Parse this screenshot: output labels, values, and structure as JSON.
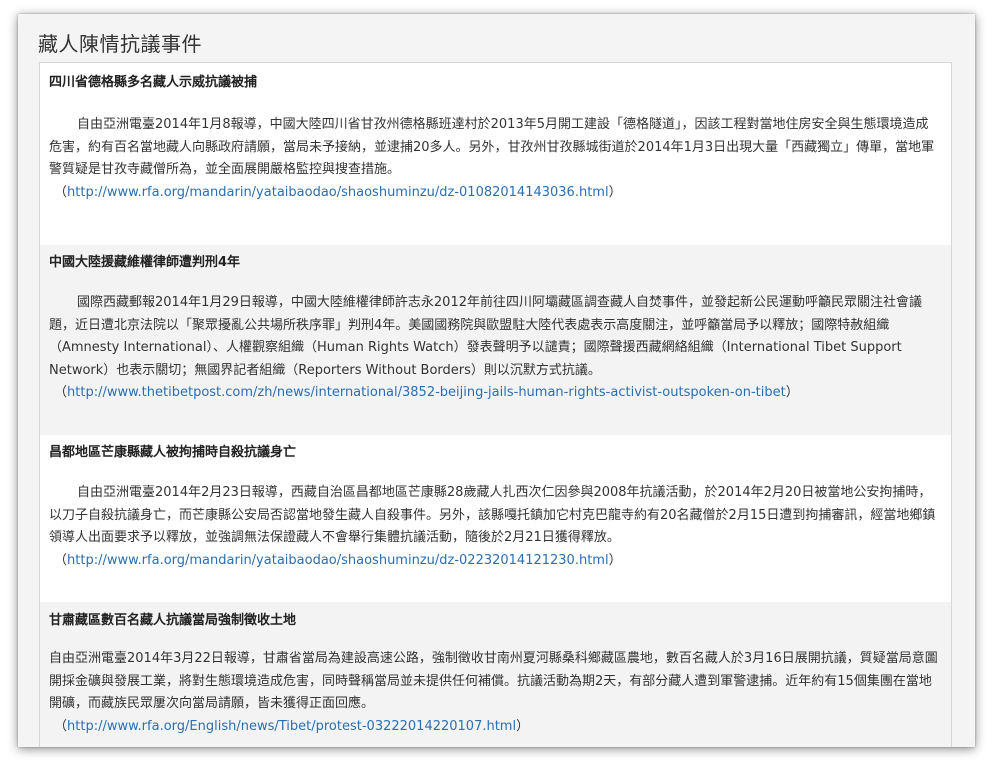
{
  "page": {
    "title": "藏人陳情抗議事件"
  },
  "articles": [
    {
      "title": "四川省德格縣多名藏人示威抗議被捕",
      "body": "自由亞洲電臺2014年1月8報導，中國大陸四川省甘孜州德格縣班達村於2013年5月開工建設「德格隧道」，因該工程對當地住房安全與生態環境造成危害，約有百名當地藏人向縣政府請願，當局未予接納，並逮捕20多人。另外，甘孜州甘孜縣城街道於2014年1月3日出現大量「西藏獨立」傳單，當地軍警質疑是甘孜寺藏僧所為，並全面展開嚴格監控與搜查措施。",
      "link_open": "（",
      "link": "http://www.rfa.org/mandarin/yataibaodao/shaoshuminzu/dz-01082014143036.html",
      "link_close": "）"
    },
    {
      "title": "中國大陸援藏維權律師遭判刑4年",
      "body": "國際西藏郵報2014年1月29日報導，中國大陸維權律師許志永2012年前往四川阿壩藏區調查藏人自焚事件，並發起新公民運動呼籲民眾關注社會議題，近日遭北京法院以「聚眾擾亂公共場所秩序罪」判刑4年。美國國務院與歐盟駐大陸代表處表示高度關注，並呼籲當局予以釋放；國際特赦組織（Amnesty International）、人權觀察組織（Human Rights Watch）發表聲明予以譴責；國際聲援西藏網絡組織（International Tibet Support Network）也表示關切；無國界記者組織（Reporters Without Borders）則以沉默方式抗議。",
      "link_open": "（",
      "link": "http://www.thetibetpost.com/zh/news/international/3852-beijing-jails-human-rights-activist-outspoken-on-tibet",
      "link_close": "）"
    },
    {
      "title": "昌都地區芒康縣藏人被拘捕時自殺抗議身亡",
      "body": "自由亞洲電臺2014年2月23日報導，西藏自治區昌都地區芒康縣28歲藏人扎西次仁因參與2008年抗議活動，於2014年2月20日被當地公安拘捕時，以刀子自殺抗議身亡，而芒康縣公安局否認當地發生藏人自殺事件。另外，該縣嘎托鎮加它村克巴龍寺約有20名藏僧於2月15日遭到拘捕審訊，經當地鄉鎮領導人出面要求予以釋放，並強調無法保證藏人不會舉行集體抗議活動，隨後於2月21日獲得釋放。",
      "link_open": "（",
      "link": "http://www.rfa.org/mandarin/yataibaodao/shaoshuminzu/dz-02232014121230.html",
      "link_close": "）"
    },
    {
      "title": "甘肅藏區數百名藏人抗議當局強制徵收土地",
      "body": "自由亞洲電臺2014年3月22日報導，甘肅省當局為建設高速公路，強制徵收甘南州夏河縣桑科鄉藏區農地，數百名藏人於3月16日展開抗議，質疑當局意圖開採金礦與發展工業，將對生態環境造成危害，同時聲稱當局並未提供任何補償。抗議活動為期2天，有部分藏人遭到軍警逮捕。近年約有15個集團在當地開礦，而藏族民眾屢次向當局請願，皆未獲得正面回應。",
      "link_open": "（",
      "link": "http://www.rfa.org/English/news/Tibet/protest-03222014220107.html",
      "link_close": "）"
    }
  ]
}
